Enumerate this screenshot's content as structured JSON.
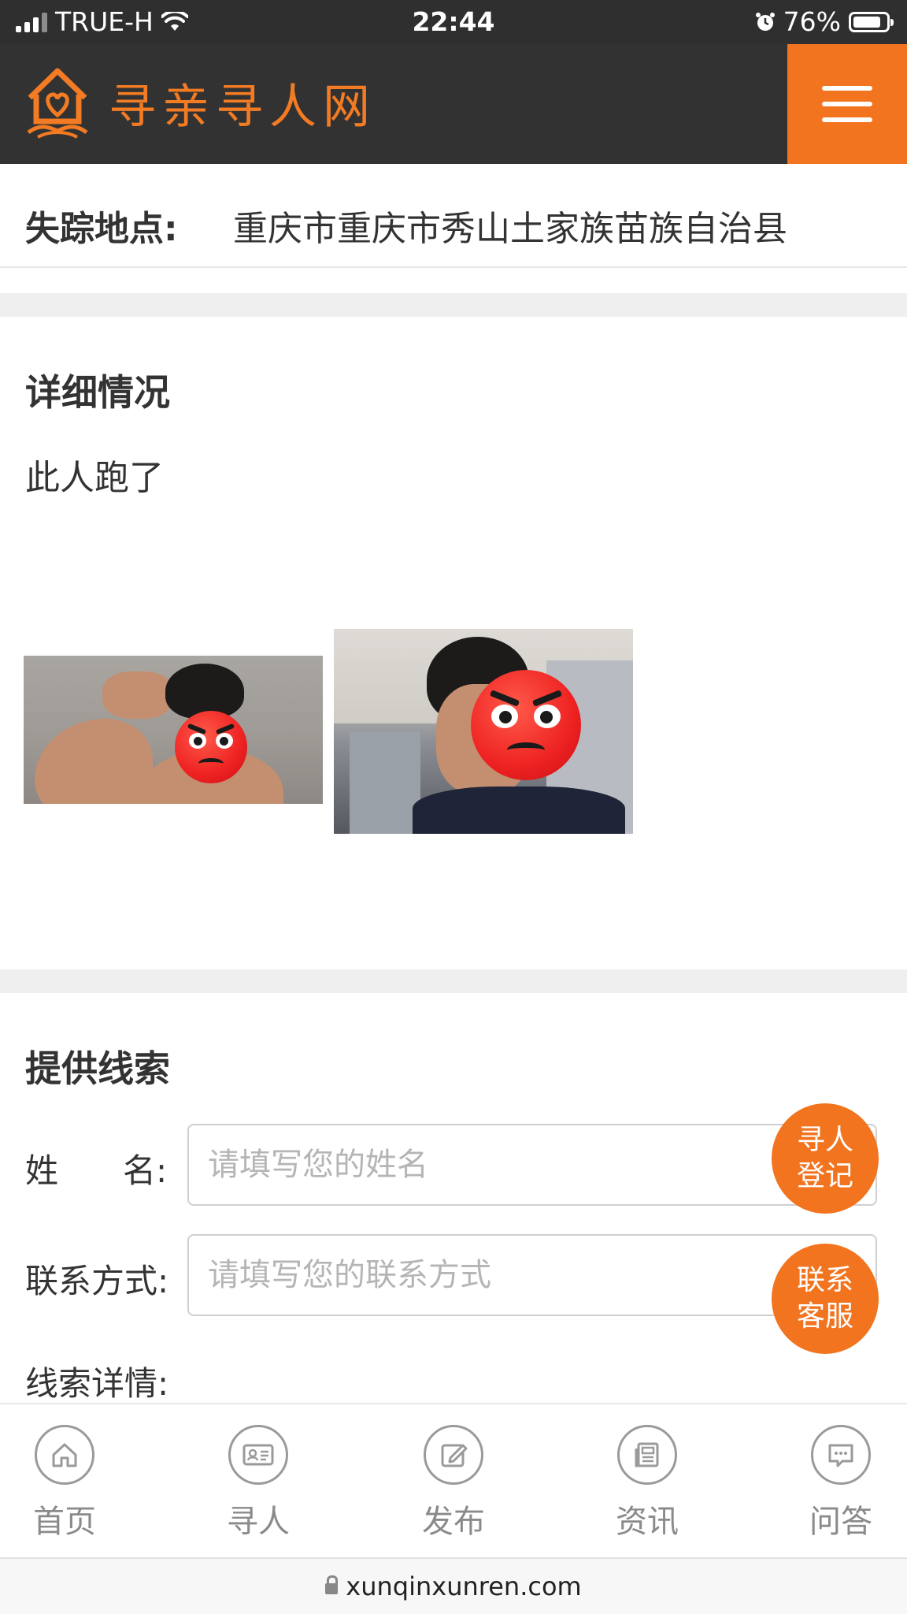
{
  "status_bar": {
    "carrier": "TRUE-H",
    "time": "22:44",
    "battery": "76%"
  },
  "header": {
    "site_name": "寻亲寻人网"
  },
  "missing_location": {
    "label": "失踪地点:",
    "value": "重庆市重庆市秀山土家族苗族自治县"
  },
  "details": {
    "title": "详细情况",
    "text": "此人跑了"
  },
  "clues_form": {
    "title": "提供线索",
    "name_label_1": "姓",
    "name_label_2": "名:",
    "name_placeholder": "请填写您的姓名",
    "contact_label": "联系方式:",
    "contact_placeholder": "请填写您的联系方式",
    "clue_label": "线索详情:"
  },
  "floating_buttons": [
    {
      "line1": "寻人",
      "line2": "登记"
    },
    {
      "line1": "联系",
      "line2": "客服"
    }
  ],
  "bottom_nav": [
    {
      "label": "首页",
      "icon": "home-icon"
    },
    {
      "label": "寻人",
      "icon": "id-card-icon"
    },
    {
      "label": "发布",
      "icon": "edit-icon"
    },
    {
      "label": "资讯",
      "icon": "news-icon"
    },
    {
      "label": "问答",
      "icon": "chat-icon"
    }
  ],
  "url": "xunqinxunren.com",
  "colors": {
    "accent": "#f2741f",
    "header_bg": "#323232"
  }
}
